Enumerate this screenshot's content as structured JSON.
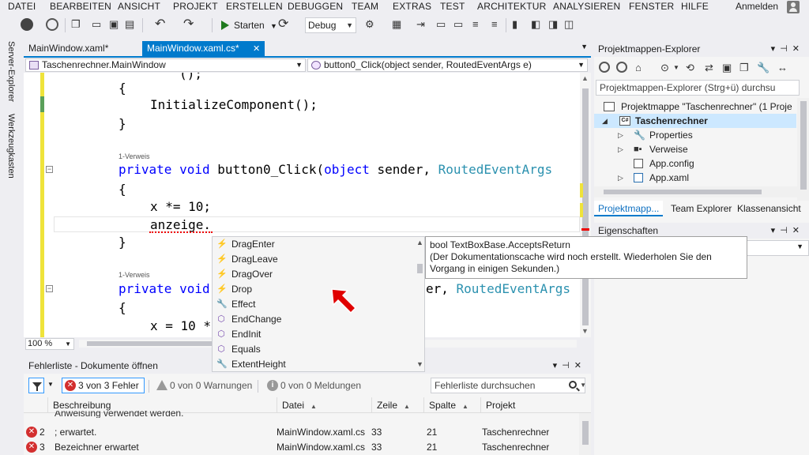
{
  "menubar": {
    "items": [
      "DATEI",
      "BEARBEITEN",
      "ANSICHT",
      "PROJEKT",
      "ERSTELLEN",
      "DEBUGGEN",
      "TEAM",
      "EXTRAS",
      "TEST",
      "ARCHITEKTUR",
      "ANALYSIEREN",
      "FENSTER",
      "HILFE"
    ],
    "login": "Anmelden"
  },
  "toolbar": {
    "start_label": "Starten",
    "config": "Debug"
  },
  "left_tabs": {
    "server_explorer": "Server-Explorer",
    "toolbox": "Werkzeugkasten"
  },
  "doc_tabs": [
    {
      "label": "MainWindow.xaml*",
      "active": false
    },
    {
      "label": "MainWindow.xaml.cs*",
      "active": true
    }
  ],
  "nav": {
    "class_scope": "Taschenrechner.MainWindow",
    "member_scope": "button0_Click(object sender, RoutedEventArgs e)"
  },
  "editor": {
    "lines": {
      "l_open1": "{",
      "l_init": "InitializeComponent();",
      "l_close1": "}",
      "ref1": "1-Verweis",
      "l_sig1_kw": "private void",
      "l_sig1_name": " button0_Click(",
      "l_sig1_obj": "object",
      "l_sig1_sender": " sender, ",
      "l_sig1_type": "RoutedEventArgs",
      "l_open2": "{",
      "l_x": "x *= 10;",
      "l_anzeige": "anzeige.",
      "l_close2": "}",
      "ref2": "1-Verweis",
      "l_sig2_kw": "private void",
      "l_sig2_rest": "er, ",
      "l_sig2_type": "RoutedEventArgs",
      "l_open3": "{",
      "l_x2": "x = 10 *"
    }
  },
  "zoom": "100 %",
  "completion": {
    "items": [
      {
        "label": "DragEnter",
        "icon": "event-icon"
      },
      {
        "label": "DragLeave",
        "icon": "event-icon"
      },
      {
        "label": "DragOver",
        "icon": "event-icon"
      },
      {
        "label": "Drop",
        "icon": "event-icon"
      },
      {
        "label": "Effect",
        "icon": "property-icon"
      },
      {
        "label": "EndChange",
        "icon": "method-icon"
      },
      {
        "label": "EndInit",
        "icon": "method-icon"
      },
      {
        "label": "Equals",
        "icon": "method-icon"
      },
      {
        "label": "ExtentHeight",
        "icon": "property-icon"
      }
    ]
  },
  "tooltip": {
    "signature": "bool TextBoxBase.AcceptsReturn",
    "message": "(Der Dokumentationscache wird noch erstellt. Wiederholen Sie den Vorgang in einigen Sekunden.)"
  },
  "error_list": {
    "title": "Fehlerliste - Dokumente öffnen",
    "errors_btn": "3 von 3 Fehler",
    "warnings_btn": "0 von 0 Warnungen",
    "messages_btn": "0 von 0 Meldungen",
    "search_placeholder": "Fehlerliste durchsuchen",
    "columns": [
      "Beschreibung",
      "Datei",
      "Zeile",
      "Spalte",
      "Projekt"
    ],
    "rows": [
      {
        "num": "",
        "desc": "Anweisung verwendet werden.",
        "file": "",
        "line": "",
        "col": "",
        "project": ""
      },
      {
        "num": "2",
        "desc": "; erwartet.",
        "file": "MainWindow.xaml.cs",
        "line": "33",
        "col": "21",
        "project": "Taschenrechner"
      },
      {
        "num": "3",
        "desc": "Bezeichner erwartet",
        "file": "MainWindow.xaml.cs",
        "line": "33",
        "col": "21",
        "project": "Taschenrechner"
      }
    ]
  },
  "solution_explorer": {
    "title": "Projektmappen-Explorer",
    "search_placeholder": "Projektmappen-Explorer (Strg+ü) durchsu",
    "tree": {
      "solution": "Projektmappe \"Taschenrechner\" (1 Proje",
      "project": "Taschenrechner",
      "properties": "Properties",
      "references": "Verweise",
      "appconfig": "App.config",
      "appxaml": "App.xaml"
    },
    "tabs": [
      "Projektmapp...",
      "Team Explorer",
      "Klassenansicht"
    ]
  },
  "properties": {
    "title": "Eigenschaften"
  }
}
